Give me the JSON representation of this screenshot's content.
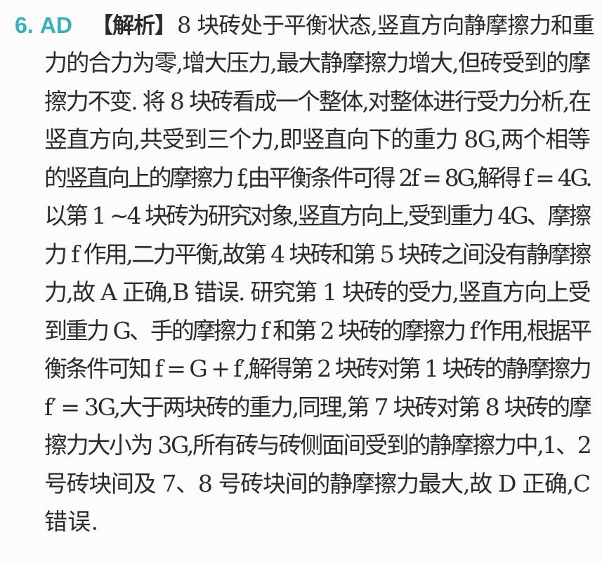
{
  "question": {
    "number": "6.",
    "answer": "AD",
    "analysis_label": "【解析】"
  },
  "lines": [
    "8 块砖处于平衡状态,竖直方向静摩擦力和重",
    "力的合力为零,增大压力,最大静摩擦力增大,但砖受到的摩",
    "擦力不变. 将 8 块砖看成一个整体,对整体进行受力分析,在",
    "竖直方向,共受到三个力,即竖直向下的重力 8G,两个相等",
    "的竖直向上的摩擦力 f,由平衡条件可得 2f = 8G,解得 f = 4G.",
    "以第 1 ~4 块砖为研究对象,竖直方向上,受到重力 4G、摩擦",
    "力 f 作用,二力平衡,故第 4 块砖和第 5 块砖之间没有静摩擦",
    "力,故 A 正确,B 错误. 研究第 1 块砖的受力,竖直方向上受",
    "到重力 G、手的摩擦力 f 和第 2 块砖的摩擦力 f′作用,根据平",
    "衡条件可知 f = G + f′,解得第 2 块砖对第 1 块砖的静摩擦力",
    "f′ = 3G,大于两块砖的重力,同理,第 7 块砖对第 8 块砖的摩",
    "擦力大小为 3G,所有砖与砖侧面间受到的静摩擦力中,1、2",
    "号砖块间及 7、8 号砖块间的静摩擦力最大,故 D 正确,C",
    "错误."
  ]
}
